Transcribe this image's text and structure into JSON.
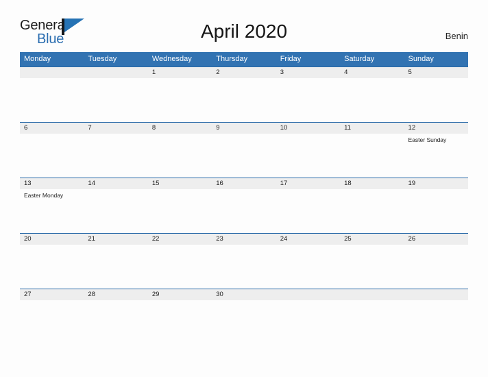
{
  "brand": {
    "name_part1": "General",
    "name_part2": "Blue",
    "mark_icon": "triangle-flag-icon",
    "color_primary": "#2572b4",
    "color_dark": "#15181c"
  },
  "header": {
    "title": "April 2020",
    "region": "Benin"
  },
  "calendar": {
    "accent_color": "#3273b2",
    "band_color": "#eeeeee",
    "rule_color": "#2a6aa8",
    "weekdays": [
      "Monday",
      "Tuesday",
      "Wednesday",
      "Thursday",
      "Friday",
      "Saturday",
      "Sunday"
    ],
    "weeks": [
      [
        {
          "day": "",
          "event": ""
        },
        {
          "day": "",
          "event": ""
        },
        {
          "day": "1",
          "event": ""
        },
        {
          "day": "2",
          "event": ""
        },
        {
          "day": "3",
          "event": ""
        },
        {
          "day": "4",
          "event": ""
        },
        {
          "day": "5",
          "event": ""
        }
      ],
      [
        {
          "day": "6",
          "event": ""
        },
        {
          "day": "7",
          "event": ""
        },
        {
          "day": "8",
          "event": ""
        },
        {
          "day": "9",
          "event": ""
        },
        {
          "day": "10",
          "event": ""
        },
        {
          "day": "11",
          "event": ""
        },
        {
          "day": "12",
          "event": "Easter Sunday"
        }
      ],
      [
        {
          "day": "13",
          "event": "Easter Monday"
        },
        {
          "day": "14",
          "event": ""
        },
        {
          "day": "15",
          "event": ""
        },
        {
          "day": "16",
          "event": ""
        },
        {
          "day": "17",
          "event": ""
        },
        {
          "day": "18",
          "event": ""
        },
        {
          "day": "19",
          "event": ""
        }
      ],
      [
        {
          "day": "20",
          "event": ""
        },
        {
          "day": "21",
          "event": ""
        },
        {
          "day": "22",
          "event": ""
        },
        {
          "day": "23",
          "event": ""
        },
        {
          "day": "24",
          "event": ""
        },
        {
          "day": "25",
          "event": ""
        },
        {
          "day": "26",
          "event": ""
        }
      ],
      [
        {
          "day": "27",
          "event": ""
        },
        {
          "day": "28",
          "event": ""
        },
        {
          "day": "29",
          "event": ""
        },
        {
          "day": "30",
          "event": ""
        },
        {
          "day": "",
          "event": ""
        },
        {
          "day": "",
          "event": ""
        },
        {
          "day": "",
          "event": ""
        }
      ]
    ]
  }
}
